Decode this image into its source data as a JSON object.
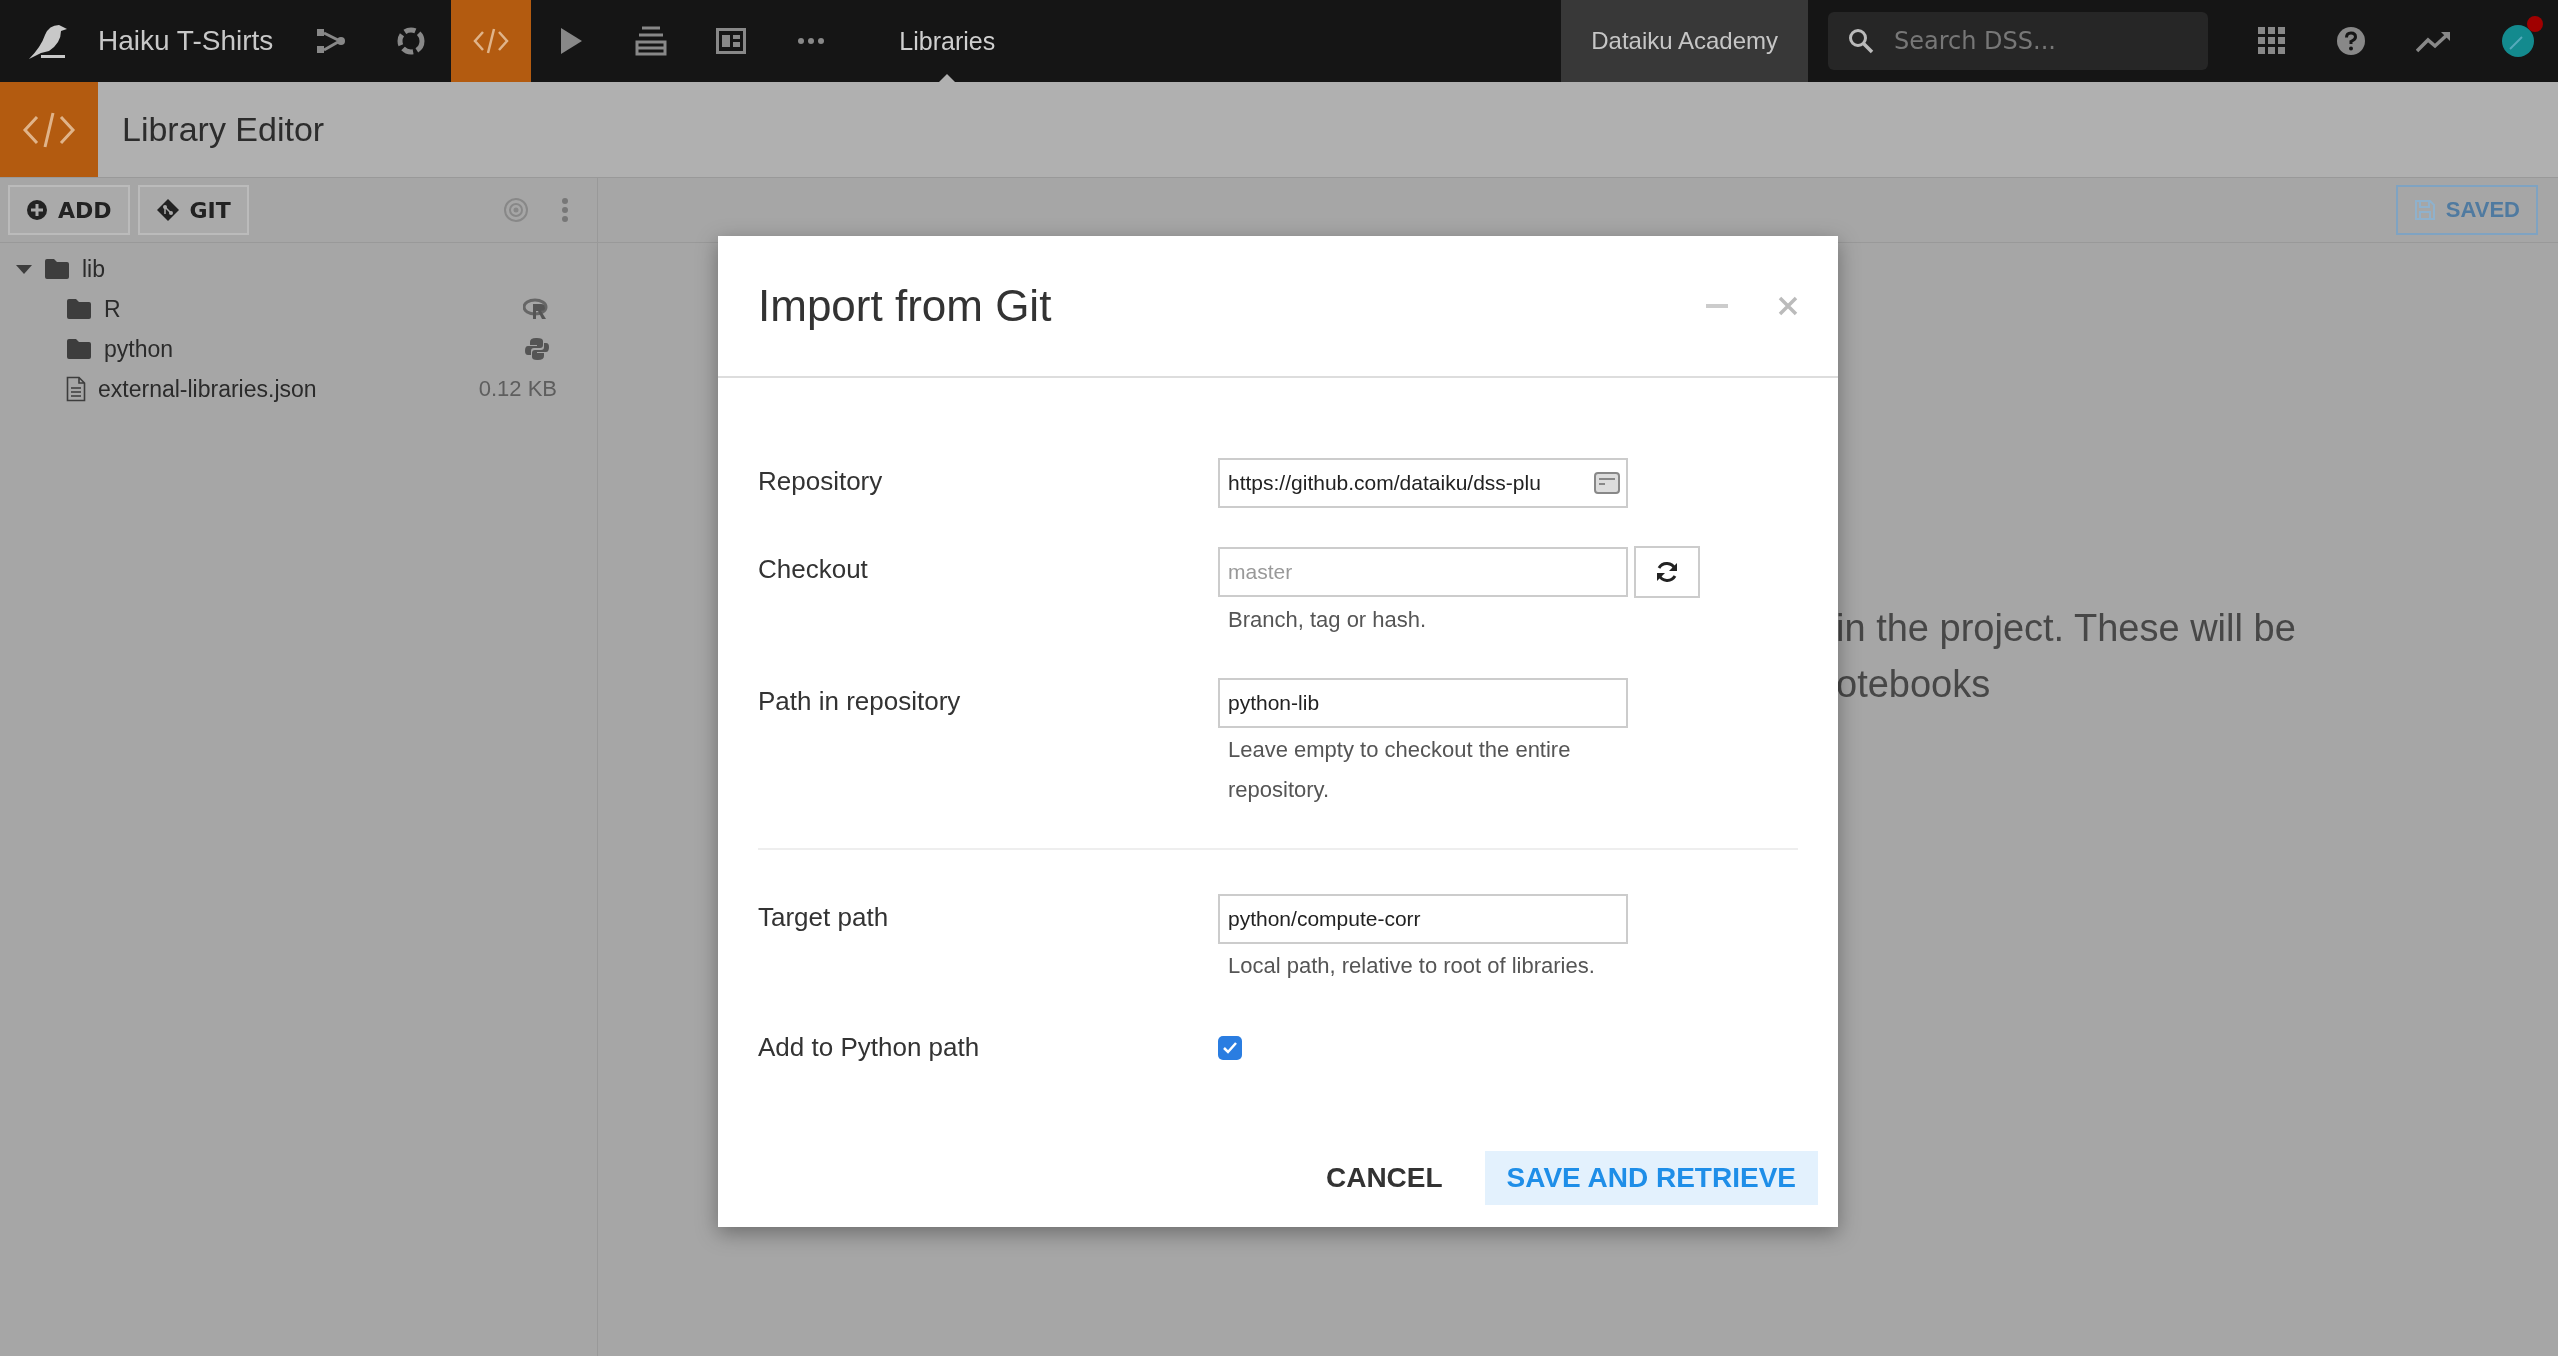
{
  "topbar": {
    "project_title": "Haiku T-Shirts",
    "nav": [
      {
        "kind": "flow",
        "selected": false
      },
      {
        "kind": "lab",
        "selected": false
      },
      {
        "kind": "code",
        "selected": true
      },
      {
        "kind": "run",
        "selected": false
      },
      {
        "kind": "stack",
        "selected": false
      },
      {
        "kind": "dashboard",
        "selected": false
      },
      {
        "kind": "more",
        "selected": false
      }
    ],
    "section": "Libraries",
    "academy": "Dataiku Academy",
    "search": {
      "placeholder": "Search DSS..."
    },
    "avatar": {
      "notification": true
    }
  },
  "header": {
    "title": "Library Editor"
  },
  "toolbar": {
    "buttons": [
      "ADD",
      "GIT"
    ],
    "saved": "SAVED"
  },
  "tree": [
    {
      "name": "lib",
      "kind": "folder",
      "expanded": true,
      "children": [
        {
          "name": "R",
          "kind": "r_folder"
        },
        {
          "name": "python",
          "kind": "python_folder"
        },
        {
          "name": "external-libraries.json",
          "kind": "file",
          "size": "0.12 KB"
        }
      ]
    }
  ],
  "background_text": [
    "in the project. These will be",
    "otebooks"
  ],
  "dialog": {
    "title": "Import from Git",
    "source_fields": [
      {
        "label": "Repository",
        "value": "https://github.com/dataiku/dss-plu",
        "kind": "text"
      },
      {
        "label": "Checkout",
        "placeholder": "master",
        "help": "Branch, tag or hash.",
        "kind": "refresh"
      },
      {
        "label": "Path in repository",
        "value": "python-lib",
        "help": "Leave empty to checkout the entire repository.",
        "kind": "text"
      }
    ],
    "target_fields": [
      {
        "label": "Target path",
        "value": "python/compute-corr",
        "help": "Local path, relative to root of libraries.",
        "kind": "text"
      },
      {
        "label": "Add to Python path",
        "checked": true,
        "kind": "checkbox"
      }
    ],
    "buttons": [
      {
        "label": "CANCEL",
        "kind": "secondary"
      },
      {
        "label": "SAVE AND RETRIEVE",
        "kind": "primary"
      }
    ]
  }
}
